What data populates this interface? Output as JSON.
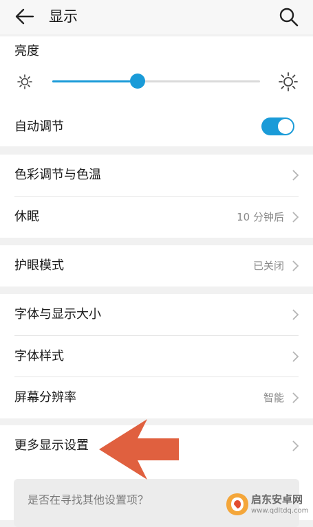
{
  "header": {
    "title": "显示"
  },
  "brightness": {
    "label": "亮度",
    "level_percent": 41
  },
  "auto_adjust": {
    "label": "自动调节",
    "enabled": true
  },
  "section2": {
    "items": [
      {
        "label": "色彩调节与色温",
        "value": ""
      },
      {
        "label": "休眠",
        "value": "10 分钟后"
      }
    ]
  },
  "section3": {
    "items": [
      {
        "label": "护眼模式",
        "value": "已关闭"
      }
    ]
  },
  "section4": {
    "items": [
      {
        "label": "字体与显示大小",
        "value": ""
      },
      {
        "label": "字体样式",
        "value": ""
      },
      {
        "label": "屏幕分辨率",
        "value": "智能"
      }
    ]
  },
  "section5": {
    "items": [
      {
        "label": "更多显示设置",
        "value": ""
      }
    ]
  },
  "suggestion": {
    "text": "是否在寻找其他设置项？"
  },
  "watermark": {
    "name": "启东安卓网",
    "url": "www.qdltdq.com"
  },
  "colors": {
    "accent": "#1a9bd8",
    "annotation_arrow": "#e0603f"
  }
}
